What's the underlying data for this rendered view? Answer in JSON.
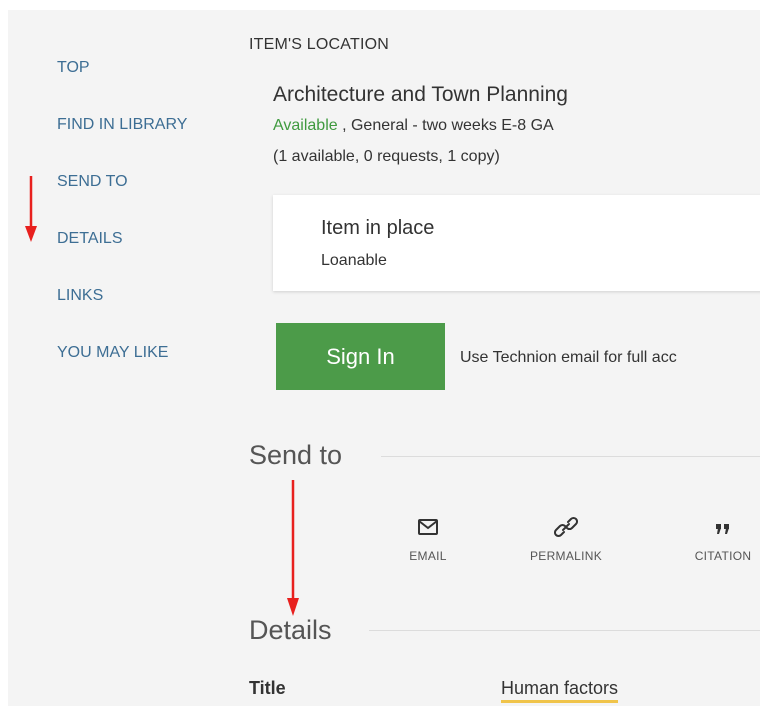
{
  "nav": {
    "items": [
      {
        "label": "TOP"
      },
      {
        "label": "FIND IN LIBRARY"
      },
      {
        "label": "SEND TO"
      },
      {
        "label": "DETAILS"
      },
      {
        "label": "LINKS"
      },
      {
        "label": "YOU MAY LIKE"
      }
    ]
  },
  "location": {
    "heading": "ITEM'S LOCATION",
    "library": "Architecture and Town Planning",
    "status": "Available",
    "location_detail": " , General - two weeks E-8 GA",
    "counts": "(1 available, 0 requests, 1 copy)"
  },
  "item_card": {
    "status": "Item in place",
    "policy": "Loanable"
  },
  "signin": {
    "button_label": "Sign In",
    "message": "Use Technion email for full acc"
  },
  "send_to": {
    "title": "Send to",
    "actions": [
      {
        "label": "EMAIL",
        "icon": "envelope-icon"
      },
      {
        "label": "PERMALINK",
        "icon": "link-icon"
      },
      {
        "label": "CITATION",
        "icon": "quote-icon"
      }
    ]
  },
  "details": {
    "title": "Details",
    "rows": [
      {
        "label": "Title",
        "value": "Human factors"
      }
    ]
  },
  "colors": {
    "nav_link": "#3d6e94",
    "available": "#3f9a3f",
    "signin_button": "#4c9b49",
    "annotation_arrow": "#e8201e",
    "highlight_underline": "#f0c44a"
  }
}
